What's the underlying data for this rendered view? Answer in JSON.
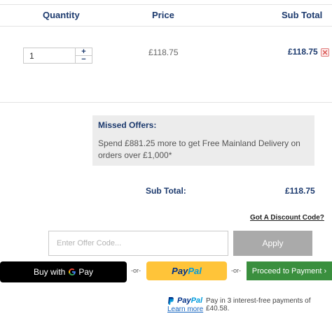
{
  "table": {
    "headers": {
      "quantity": "Quantity",
      "price": "Price",
      "subtotal": "Sub Total"
    },
    "row": {
      "quantity": "1",
      "plus": "+",
      "minus": "−",
      "price": "£118.75",
      "subtotal": "£118.75"
    }
  },
  "missed_offers": {
    "title": "Missed Offers:",
    "text": "Spend £881.25 more to get Free Mainland Delivery on orders over £1,000*"
  },
  "summary": {
    "label": "Sub Total:",
    "value": "£118.75"
  },
  "discount": {
    "link_label": "Got A Discount Code?",
    "placeholder": "Enter Offer Code...",
    "apply_label": "Apply"
  },
  "checkout": {
    "gpay_label": "Buy with",
    "gpay_pay": "Pay",
    "or_label": "-or-",
    "paypal_part1": "Pay",
    "paypal_part2": "Pal",
    "proceed_label": "Proceed to Payment ›"
  },
  "paylater": {
    "brand_part1": "Pay",
    "brand_part2": "Pal",
    "text": "Pay in 3 interest-free payments of £40.58.",
    "learn_more": "Learn more"
  },
  "colors": {
    "brand_navy": "#1c3a6e",
    "proceed_green": "#3a8f3e",
    "paypal_yellow": "#ffc439",
    "apply_grey": "#aaaaaa",
    "offers_bg": "#ececec"
  }
}
